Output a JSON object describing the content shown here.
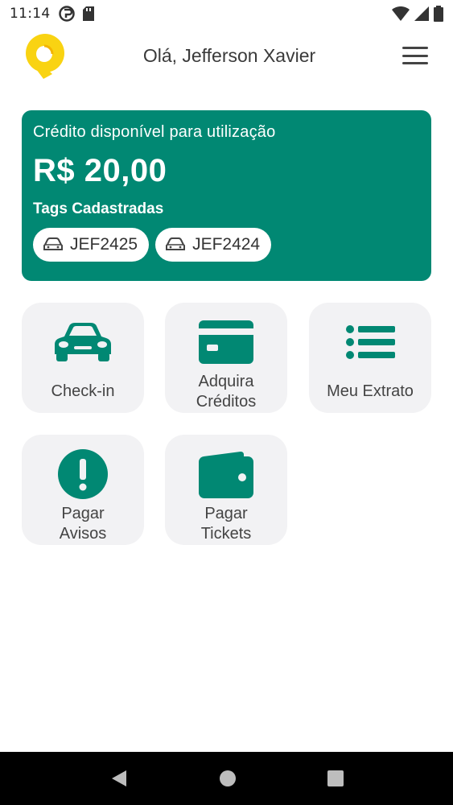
{
  "status_bar": {
    "time": "11:14"
  },
  "header": {
    "greeting": "Olá, Jefferson Xavier"
  },
  "credit": {
    "label": "Crédito disponível para utilização",
    "amount": "R$ 20,00",
    "tags_label": "Tags Cadastradas",
    "tags": [
      "JEF2425",
      "JEF2424"
    ]
  },
  "actions": {
    "checkin": {
      "label": "Check-in",
      "icon": "car-icon"
    },
    "credits": {
      "line1": "Adquira",
      "line2": "Créditos",
      "icon": "credit-card-icon"
    },
    "statement": {
      "label": "Meu Extrato",
      "icon": "list-icon"
    },
    "notices": {
      "line1": "Pagar",
      "line2": "Avisos",
      "icon": "exclamation-circle-icon"
    },
    "tickets": {
      "line1": "Pagar",
      "line2": "Tickets",
      "icon": "wallet-icon"
    }
  },
  "colors": {
    "primary": "#018873",
    "logo_yellow": "#f9d312",
    "tile_background": "#f2f2f4"
  }
}
